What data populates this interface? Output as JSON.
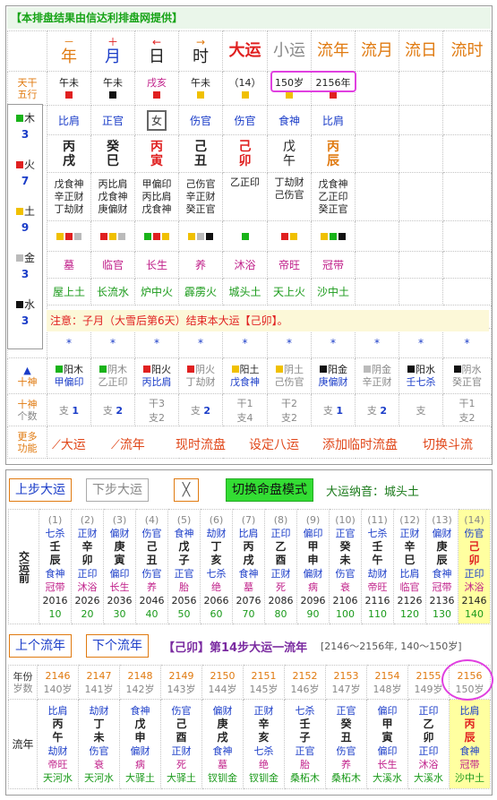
{
  "banner": "【本排盘结果由信达利排盘网提供】",
  "header": {
    "cols": [
      {
        "sym": "－",
        "name": "年",
        "cls": "org"
      },
      {
        "sym": "＋",
        "name": "月",
        "cls": "red"
      },
      {
        "sym": "←",
        "name": "日",
        "cls": "red"
      },
      {
        "sym": "→",
        "name": "时",
        "cls": "org"
      }
    ],
    "dayun": "大运",
    "xiaoyun": "小运",
    "liunian": "流年",
    "liuyue": "流月",
    "liuri": "流日",
    "liushi": "流时"
  },
  "row_labels": {
    "tiangan": "天干",
    "wuxing": "五行",
    "shishen": "十神",
    "count": "个数",
    "more": "更多",
    "func": "功能"
  },
  "tgwx": [
    "午未",
    "午未",
    "戌亥",
    "午未",
    "（14）",
    "150岁",
    "2156年"
  ],
  "shishen_top": [
    "比肩",
    "正官",
    "女",
    "伤官",
    "伤官",
    "食神",
    "比肩"
  ],
  "ganzhi": [
    [
      "丙",
      "戌"
    ],
    [
      "癸",
      "巳"
    ],
    [
      "丙",
      "寅"
    ],
    [
      "己",
      "丑"
    ],
    [
      "己",
      "卯"
    ],
    [
      "戊",
      "午"
    ],
    [
      "丙",
      "辰"
    ]
  ],
  "canggan": [
    [
      "戊食神",
      "辛正财",
      "丁劫财"
    ],
    [
      "丙比肩",
      "戊食神",
      "庚偏财"
    ],
    [
      "甲偏印",
      "丙比肩",
      "戊食神"
    ],
    [
      "己伤官",
      "辛正财",
      "癸正官"
    ],
    [
      "乙正印"
    ],
    [
      "丁劫财",
      "己伤官"
    ],
    [
      "戊食神",
      "乙正印",
      "癸正官"
    ]
  ],
  "changsheng": [
    "墓",
    "临官",
    "长生",
    "养",
    "沐浴",
    "帝旺",
    "冠带"
  ],
  "nayin": [
    "屋上土",
    "长流水",
    "炉中火",
    "霹雳火",
    "城头土",
    "天上火",
    "沙中土"
  ],
  "wuxing_side": [
    {
      "name": "木",
      "n": "3",
      "color": "#19b319"
    },
    {
      "name": "火",
      "n": "7",
      "color": "#e02020"
    },
    {
      "name": "土",
      "n": "9",
      "color": "#f0c000"
    },
    {
      "name": "金",
      "n": "3",
      "color": "#bbbbbb"
    },
    {
      "name": "水",
      "n": "3",
      "color": "#111111"
    }
  ],
  "note": "注意：子月（大雪后第6天）结束本大运【己卯】。",
  "star": "*",
  "tg_list": [
    [
      "阳木",
      "甲偏印"
    ],
    [
      "阴木",
      "乙正印"
    ],
    [
      "阳火",
      "丙比肩"
    ],
    [
      "阴火",
      "丁劫财"
    ],
    [
      "阳土",
      "戊食神"
    ],
    [
      "阴土",
      "己伤官"
    ],
    [
      "阳金",
      "庚偏财"
    ],
    [
      "阴金",
      "辛正财"
    ],
    [
      "阳水",
      "壬七杀"
    ],
    [
      "阴水",
      "癸正官"
    ]
  ],
  "counts": [
    [
      "支",
      "1"
    ],
    [
      "支",
      "2"
    ],
    [
      "干3",
      "支2"
    ],
    [
      "支",
      "2"
    ],
    [
      "干1",
      "支4"
    ],
    [
      "干2",
      "支2"
    ],
    [
      "支",
      "1"
    ],
    [
      "支",
      "2"
    ],
    [
      "支",
      ""
    ],
    [
      "干1",
      "支2"
    ]
  ],
  "links": {
    "dayun": "大运",
    "liunian": "流年",
    "xianzai": "现时流盘",
    "sheding": "设定八运",
    "tianjia": "添加临时流盘",
    "qiehuan": "切换斗流"
  },
  "bottom": {
    "prev_dayun": "上步大运",
    "next_dayun": "下步大运",
    "close": "╳",
    "switch_mode": "切换命盘模式",
    "nayin_label": "大运纳音：城头土",
    "jiaoyun": "交运前",
    "dayun_cols": [
      [
        "(1)",
        "七杀",
        "壬",
        "辰",
        "食神",
        "冠带",
        "2016",
        "10"
      ],
      [
        "(2)",
        "正财",
        "辛",
        "卯",
        "正印",
        "沐浴",
        "2026",
        "20"
      ],
      [
        "(3)",
        "偏财",
        "庚",
        "寅",
        "偏印",
        "长生",
        "2036",
        "30"
      ],
      [
        "(4)",
        "伤官",
        "己",
        "丑",
        "伤官",
        "养",
        "2046",
        "40"
      ],
      [
        "(5)",
        "食神",
        "戊",
        "子",
        "正官",
        "胎",
        "2056",
        "50"
      ],
      [
        "(6)",
        "劫财",
        "丁",
        "亥",
        "七杀",
        "绝",
        "2066",
        "60"
      ],
      [
        "(7)",
        "比肩",
        "丙",
        "戌",
        "食神",
        "墓",
        "2076",
        "70"
      ],
      [
        "(8)",
        "正印",
        "乙",
        "酉",
        "正财",
        "死",
        "2086",
        "80"
      ],
      [
        "(9)",
        "偏印",
        "甲",
        "申",
        "偏财",
        "病",
        "2096",
        "90"
      ],
      [
        "(10)",
        "正官",
        "癸",
        "未",
        "伤官",
        "衰",
        "2106",
        "100"
      ],
      [
        "(11)",
        "七杀",
        "壬",
        "午",
        "劫财",
        "帝旺",
        "2116",
        "110"
      ],
      [
        "(12)",
        "正财",
        "辛",
        "巳",
        "比肩",
        "临官",
        "2126",
        "120"
      ],
      [
        "(13)",
        "偏财",
        "庚",
        "辰",
        "食神",
        "冠带",
        "2136",
        "130"
      ],
      [
        "(14)",
        "伤官",
        "己",
        "卯",
        "正印",
        "沐浴",
        "2146",
        "140"
      ]
    ],
    "prev_ln": "上个流年",
    "next_ln": "下个流年",
    "ln_title": "【己卯】第14步大运一流年",
    "ln_range": "[2146～2156年, 140～150岁]",
    "year_label": "年份",
    "age_label": "岁数",
    "liunian_label": "流年",
    "years": [
      [
        "2146",
        "140岁"
      ],
      [
        "2147",
        "141岁"
      ],
      [
        "2148",
        "142岁"
      ],
      [
        "2149",
        "143岁"
      ],
      [
        "2150",
        "144岁"
      ],
      [
        "2151",
        "145岁"
      ],
      [
        "2152",
        "146岁"
      ],
      [
        "2153",
        "147岁"
      ],
      [
        "2154",
        "148岁"
      ],
      [
        "2155",
        "149岁"
      ],
      [
        "2156",
        "150岁"
      ]
    ],
    "ln_cols": [
      [
        "比肩",
        "丙",
        "午",
        "劫财",
        "帝旺",
        "天河水"
      ],
      [
        "劫财",
        "丁",
        "未",
        "伤官",
        "衰",
        "天河水"
      ],
      [
        "食神",
        "戊",
        "申",
        "偏财",
        "病",
        "大驿土"
      ],
      [
        "伤官",
        "己",
        "酉",
        "正财",
        "死",
        "大驿土"
      ],
      [
        "偏财",
        "庚",
        "戌",
        "食神",
        "墓",
        "钗钏金"
      ],
      [
        "正财",
        "辛",
        "亥",
        "七杀",
        "绝",
        "钗钏金"
      ],
      [
        "七杀",
        "壬",
        "子",
        "正官",
        "胎",
        "桑柘木"
      ],
      [
        "正官",
        "癸",
        "丑",
        "伤官",
        "养",
        "桑柘木"
      ],
      [
        "偏印",
        "甲",
        "寅",
        "偏印",
        "长生",
        "大溪水"
      ],
      [
        "正印",
        "乙",
        "卯",
        "正印",
        "沐浴",
        "大溪水"
      ],
      [
        "比肩",
        "丙",
        "辰",
        "食神",
        "冠带",
        "沙中土"
      ]
    ]
  }
}
